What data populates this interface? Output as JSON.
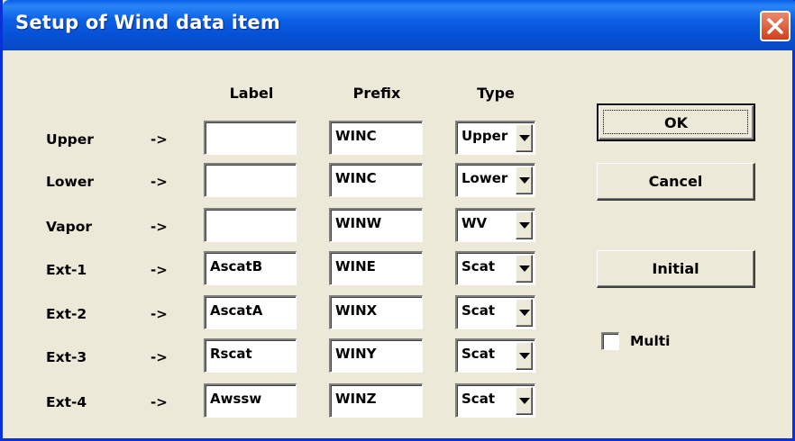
{
  "window": {
    "title": "Setup of Wind data item"
  },
  "headers": {
    "label": "Label",
    "prefix": "Prefix",
    "type": "Type"
  },
  "arrow": "->",
  "rows": [
    {
      "name": "Upper",
      "label": "",
      "prefix": "WINC",
      "type": "Upper"
    },
    {
      "name": "Lower",
      "label": "",
      "prefix": "WINC",
      "type": "Lower"
    },
    {
      "name": "Vapor",
      "label": "",
      "prefix": "WINW",
      "type": "WV"
    },
    {
      "name": "Ext-1",
      "label": "AscatB",
      "prefix": "WINE",
      "type": "Scat"
    },
    {
      "name": "Ext-2",
      "label": "AscatA",
      "prefix": "WINX",
      "type": "Scat"
    },
    {
      "name": "Ext-3",
      "label": "Rscat",
      "prefix": "WINY",
      "type": "Scat"
    },
    {
      "name": "Ext-4",
      "label": "Awssw",
      "prefix": "WINZ",
      "type": "Scat"
    }
  ],
  "buttons": {
    "ok": "OK",
    "cancel": "Cancel",
    "initial": "Initial"
  },
  "multi": {
    "label": "Multi",
    "checked": false
  },
  "icons": {
    "close": "close-icon",
    "dropdown": "chevron-down-icon"
  },
  "colors": {
    "titlebar": "#0a5fe8",
    "dialog_bg": "#ece9d8",
    "close_button": "#d0401c"
  }
}
